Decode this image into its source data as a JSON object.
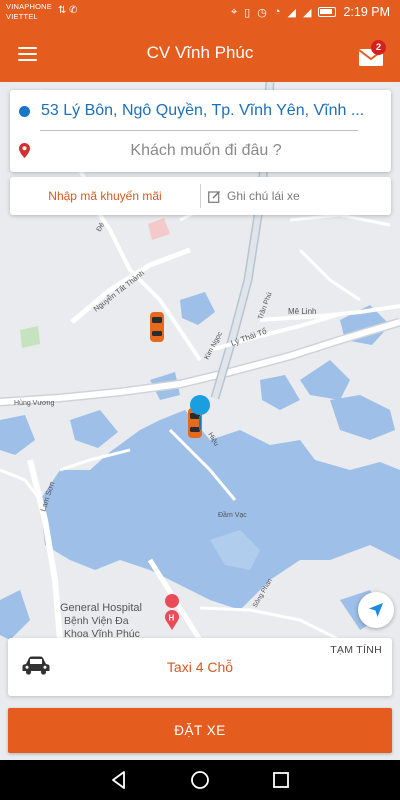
{
  "status_bar": {
    "carrier_1": "VINAPHONE",
    "carrier_2": "VIETTEL",
    "battery_pct": "100%",
    "time": "2:19 PM"
  },
  "header": {
    "title": "CV Vĩnh Phúc",
    "menu_icon": "hamburger-menu-icon",
    "mail_icon": "mail-icon",
    "mail_badge": "2"
  },
  "address": {
    "origin": "53 Lý Bôn, Ngô Quyền, Tp. Vĩnh Yên, Vĩnh ...",
    "destination_placeholder": "Khách muốn đi đâu ?",
    "destination_value": ""
  },
  "options": {
    "promo_label": "Nhập mã khuyến mãi",
    "note_label": "Ghi chú lái xe"
  },
  "map": {
    "labels": {
      "nguyen_tat_thanh": "Nguyễn Tất Thành",
      "tran_phu": "Trần Phú",
      "me_linh": "Mê Linh",
      "ly_thai_to": "Lý Thái Tổ",
      "kim_ngoc": "Kim Ngọc",
      "hung_vuong": "Hùng Vương",
      "lam_son": "Lam Sơn",
      "dam_vac": "Đầm Vạc",
      "song_phan": "Sông Phan",
      "hieu": "Hiệu",
      "de": "Đê",
      "hospital_1": "General Hospital",
      "hospital_2": "Bệnh Viện Đa",
      "hospital_3": "Khoa Vĩnh Phúc"
    },
    "colors": {
      "land": "#e9ebee",
      "water": "#9dbfe8",
      "road": "#ffffff",
      "park": "#c6e3c0"
    }
  },
  "vehicle": {
    "name": "Taxi 4 Chỗ",
    "price_label": "TẠM TÍNH",
    "icon": "car-icon"
  },
  "book_button": "ĐẶT XE",
  "nav": {
    "back": "back-icon",
    "home": "home-icon",
    "recents": "recents-icon"
  },
  "colors": {
    "brand": "#e45c1e",
    "origin_blue": "#1877c9",
    "pin_red": "#d32f2f"
  }
}
